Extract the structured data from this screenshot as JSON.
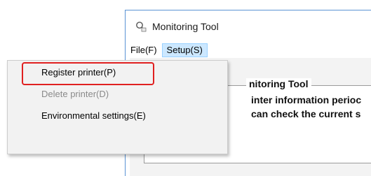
{
  "window": {
    "title": "Monitoring Tool",
    "title_icon": "magnifier-printer-icon"
  },
  "menubar": {
    "items": [
      "File(F)",
      "Setup(S)"
    ]
  },
  "groupbox": {
    "title": "nitoring Tool",
    "line1": "inter information perioc",
    "line2": "can check the current s"
  },
  "dropdown": {
    "items": [
      {
        "label": "Register printer(P)",
        "enabled": true
      },
      {
        "label": "Delete printer(D)",
        "enabled": false
      },
      {
        "label": "Environmental settings(E)",
        "enabled": true
      }
    ]
  },
  "colors": {
    "highlight": "#e02020",
    "menu_active_bg": "#cce8ff",
    "window_border": "#5a93d4"
  }
}
